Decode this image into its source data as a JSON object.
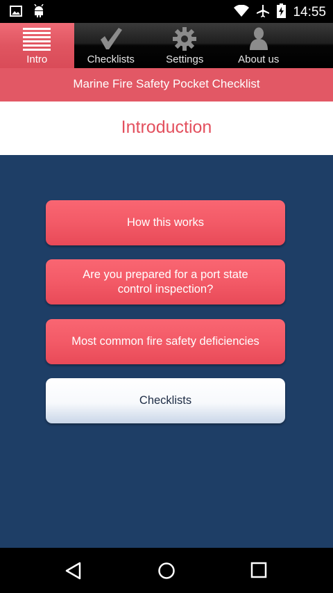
{
  "status_bar": {
    "time": "14:55",
    "icons": [
      "image-icon",
      "android-icon",
      "wifi-icon",
      "airplane-icon",
      "battery-icon"
    ]
  },
  "tabs": [
    {
      "label": "Intro",
      "icon": "list-icon",
      "active": true
    },
    {
      "label": "Checklists",
      "icon": "checkmark-icon",
      "active": false
    },
    {
      "label": "Settings",
      "icon": "gear-icon",
      "active": false
    },
    {
      "label": "About us",
      "icon": "person-icon",
      "active": false
    }
  ],
  "header": {
    "title": "Marine Fire Safety Pocket Checklist"
  },
  "page": {
    "heading": "Introduction"
  },
  "menu": [
    {
      "label": "How this works",
      "style": "red"
    },
    {
      "label": "Are you prepared for a port state control inspection?",
      "style": "red"
    },
    {
      "label": "Most common fire safety deficiencies",
      "style": "red"
    },
    {
      "label": "Checklists",
      "style": "white"
    }
  ],
  "colors": {
    "accent": "#e25865",
    "background": "#1e3e66",
    "heading_text": "#e3505e"
  },
  "nav_bar": {
    "icons": [
      "back-icon",
      "home-icon",
      "recents-icon"
    ]
  }
}
